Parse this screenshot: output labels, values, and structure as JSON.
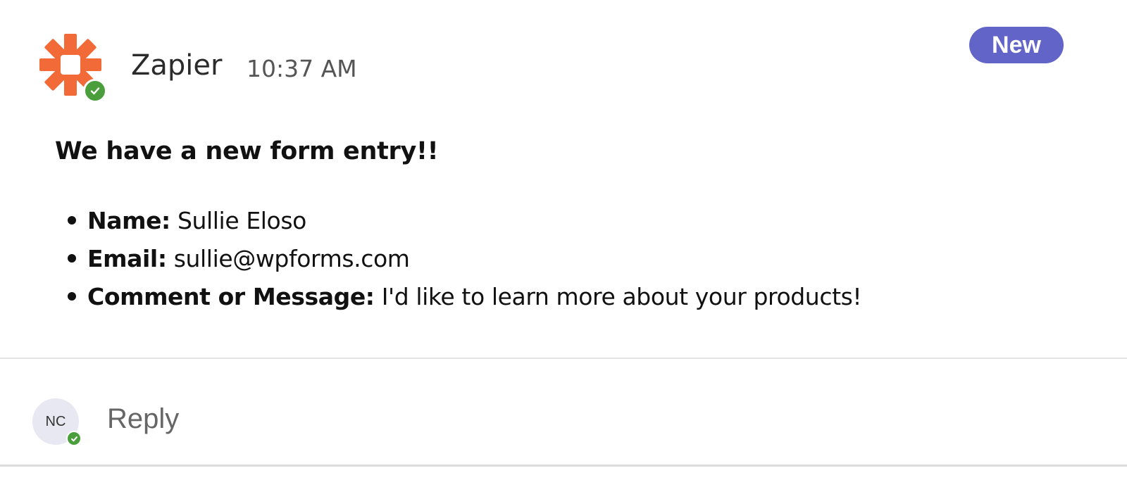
{
  "message": {
    "sender": "Zapier",
    "time": "10:37 AM",
    "badge": "New",
    "heading": "We have a new form entry!!",
    "fields": [
      {
        "label": "Name:",
        "value": "Sullie Eloso"
      },
      {
        "label": "Email:",
        "value": "sullie@wpforms.com"
      },
      {
        "label": "Comment or Message:",
        "value": "I'd like to learn more about your products!"
      }
    ]
  },
  "reply": {
    "avatar_initials": "NC",
    "label": "Reply"
  },
  "colors": {
    "zapier_orange": "#f26a38",
    "presence_green": "#4a9e3b",
    "badge_purple": "#6264c7"
  },
  "icons": {
    "sender_avatar": "zapier-logo-icon",
    "presence": "check-icon"
  }
}
